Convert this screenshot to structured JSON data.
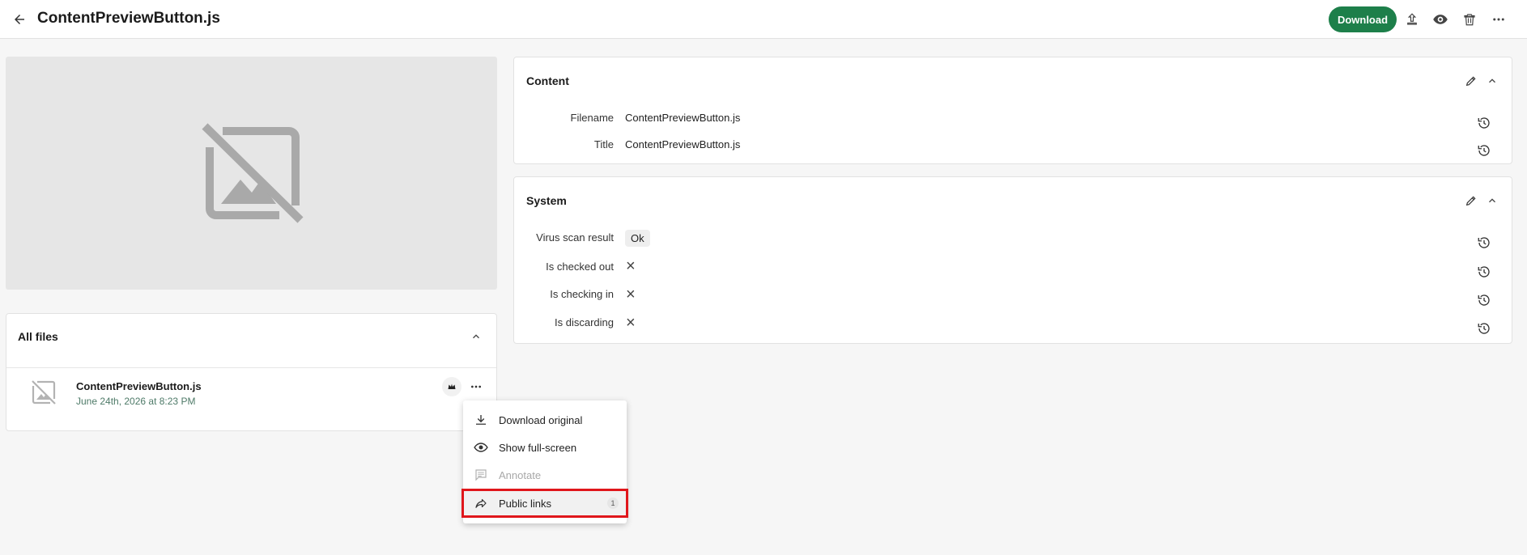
{
  "header": {
    "title": "ContentPreviewButton.js",
    "download_label": "Download",
    "icons": [
      "back-arrow-icon",
      "upload-icon",
      "eye-icon",
      "trash-icon",
      "more-horizontal-icon"
    ]
  },
  "preview": {
    "icon": "image-not-available-icon"
  },
  "content_card": {
    "title": "Content",
    "fields": [
      {
        "label": "Filename",
        "value": "ContentPreviewButton.js"
      },
      {
        "label": "Title",
        "value": "ContentPreviewButton.js"
      }
    ]
  },
  "system_card": {
    "title": "System",
    "fields": [
      {
        "label": "Virus scan result",
        "value": "Ok"
      },
      {
        "label": "Is checked out",
        "value": "×"
      },
      {
        "label": "Is checking in",
        "value": "×"
      },
      {
        "label": "Is discarding",
        "value": "×"
      }
    ]
  },
  "files_card": {
    "title": "All files",
    "items": [
      {
        "name": "ContentPreviewButton.js",
        "date": "June 24th, 2026 at 8:23 PM"
      }
    ]
  },
  "context_menu": {
    "items": [
      {
        "label": "Download original",
        "icon": "download-icon",
        "disabled": false
      },
      {
        "label": "Show full-screen",
        "icon": "eye-icon",
        "disabled": false
      },
      {
        "label": "Annotate",
        "icon": "comment-icon",
        "disabled": true
      },
      {
        "label": "Public links",
        "icon": "share-arrow-icon",
        "disabled": false,
        "count": "1"
      }
    ]
  },
  "colors": {
    "accent": "#1d7f4a",
    "date_text": "#4e7a68",
    "highlight_border": "#e0161b"
  }
}
